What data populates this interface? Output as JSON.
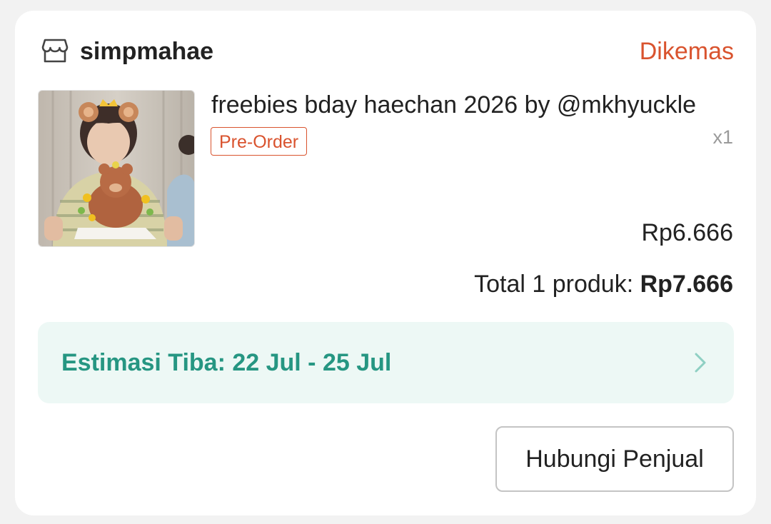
{
  "order": {
    "shop": {
      "icon": "store-icon",
      "name": "simpmahae"
    },
    "status": "Dikemas",
    "item": {
      "thumbnail_icon": "product-photo",
      "title": "freebies bday haechan 2026 by @mkhyuckle",
      "badge": "Pre-Order",
      "quantity": "x1",
      "price": "Rp6.666"
    },
    "total": {
      "label": "Total 1 produk: ",
      "amount": "Rp7.666"
    },
    "eta": {
      "text": "Estimasi Tiba: 22 Jul - 25 Jul",
      "icon": "chevron-right-icon"
    },
    "actions": {
      "contact_seller": "Hubungi Penjual"
    }
  },
  "colors": {
    "accent": "#d9532e",
    "eta_text": "#269682",
    "eta_background": "#edf8f5",
    "muted": "#9a9a9a"
  }
}
